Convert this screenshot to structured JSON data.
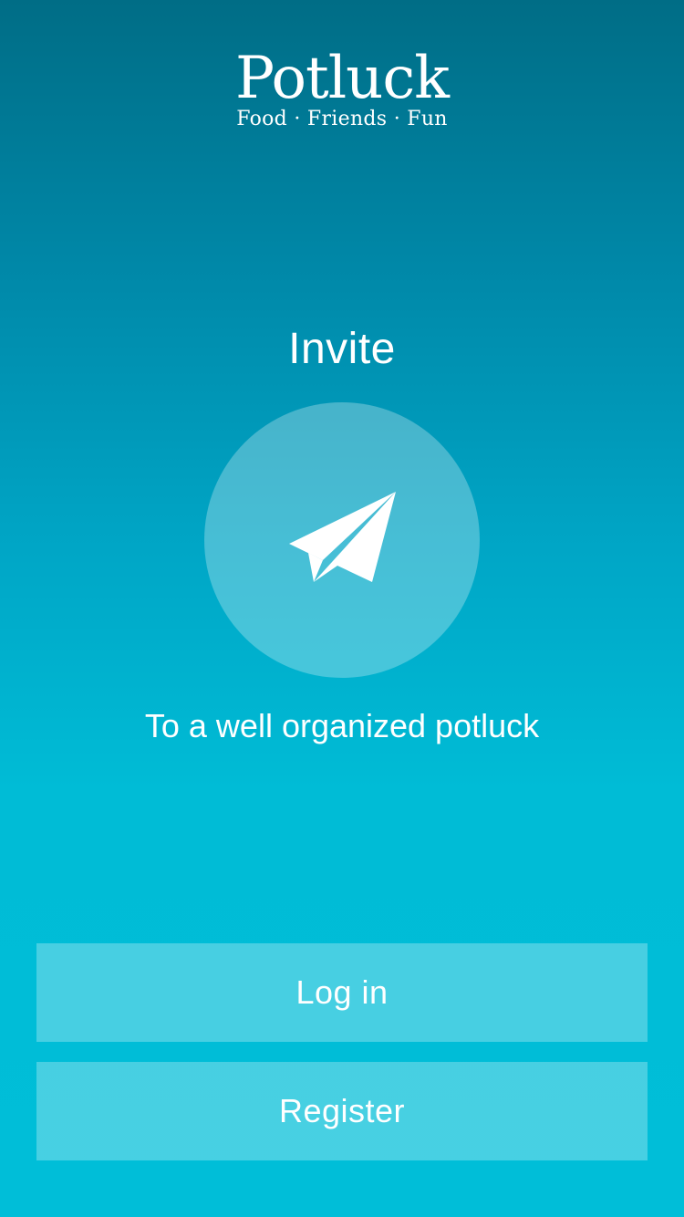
{
  "brand": {
    "title": "Potluck",
    "tagline": "Food · Friends · Fun"
  },
  "feature": {
    "title": "Invite",
    "icon": "paper-plane-icon",
    "description": "To a well organized potluck"
  },
  "actions": {
    "login_label": "Log in",
    "register_label": "Register"
  },
  "colors": {
    "gradient_top": "#006d86",
    "gradient_bottom": "#00bed8",
    "text": "#ffffff"
  }
}
